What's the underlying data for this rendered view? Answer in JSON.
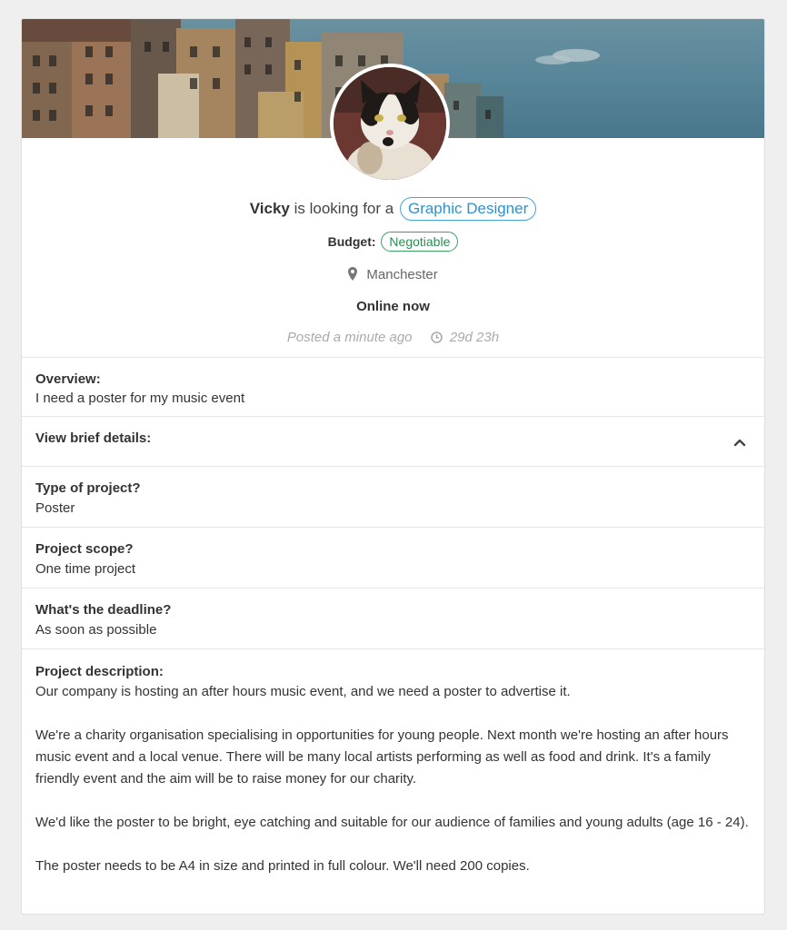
{
  "profile": {
    "name": "Vicky",
    "looking_text": "is looking for a",
    "role": "Graphic Designer",
    "budget_label": "Budget:",
    "budget_value": "Negotiable",
    "location": "Manchester",
    "status": "Online now",
    "posted": "Posted a minute ago",
    "time_left": "29d 23h"
  },
  "overview": {
    "label": "Overview:",
    "value": "I need a poster for my music event"
  },
  "brief": {
    "label": "View brief details:"
  },
  "details": [
    {
      "label": "Type of project?",
      "value": "Poster"
    },
    {
      "label": "Project scope?",
      "value": "One time project"
    },
    {
      "label": "What's the deadline?",
      "value": "As soon as possible"
    }
  ],
  "description": {
    "label": "Project description:",
    "paragraphs": [
      "Our company is hosting an after hours music event, and we need a poster to advertise it.",
      "We're a charity organisation specialising in opportunities for young people. Next month we're hosting an after hours music event and a local venue. There will be many local artists performing as well as food and drink. It's a family friendly event and the aim will be to raise money for our charity.",
      "We'd like the poster to be bright, eye catching and suitable for our audience of families and young adults (age 16 - 24).",
      "The poster needs to be A4 in size and printed in full colour. We'll need 200 copies."
    ]
  },
  "colors": {
    "role_pill": "#2e93cc",
    "budget_pill": "#2b8c52"
  },
  "icons": [
    "map-marker-icon",
    "clock-icon",
    "chevron-up-icon"
  ]
}
